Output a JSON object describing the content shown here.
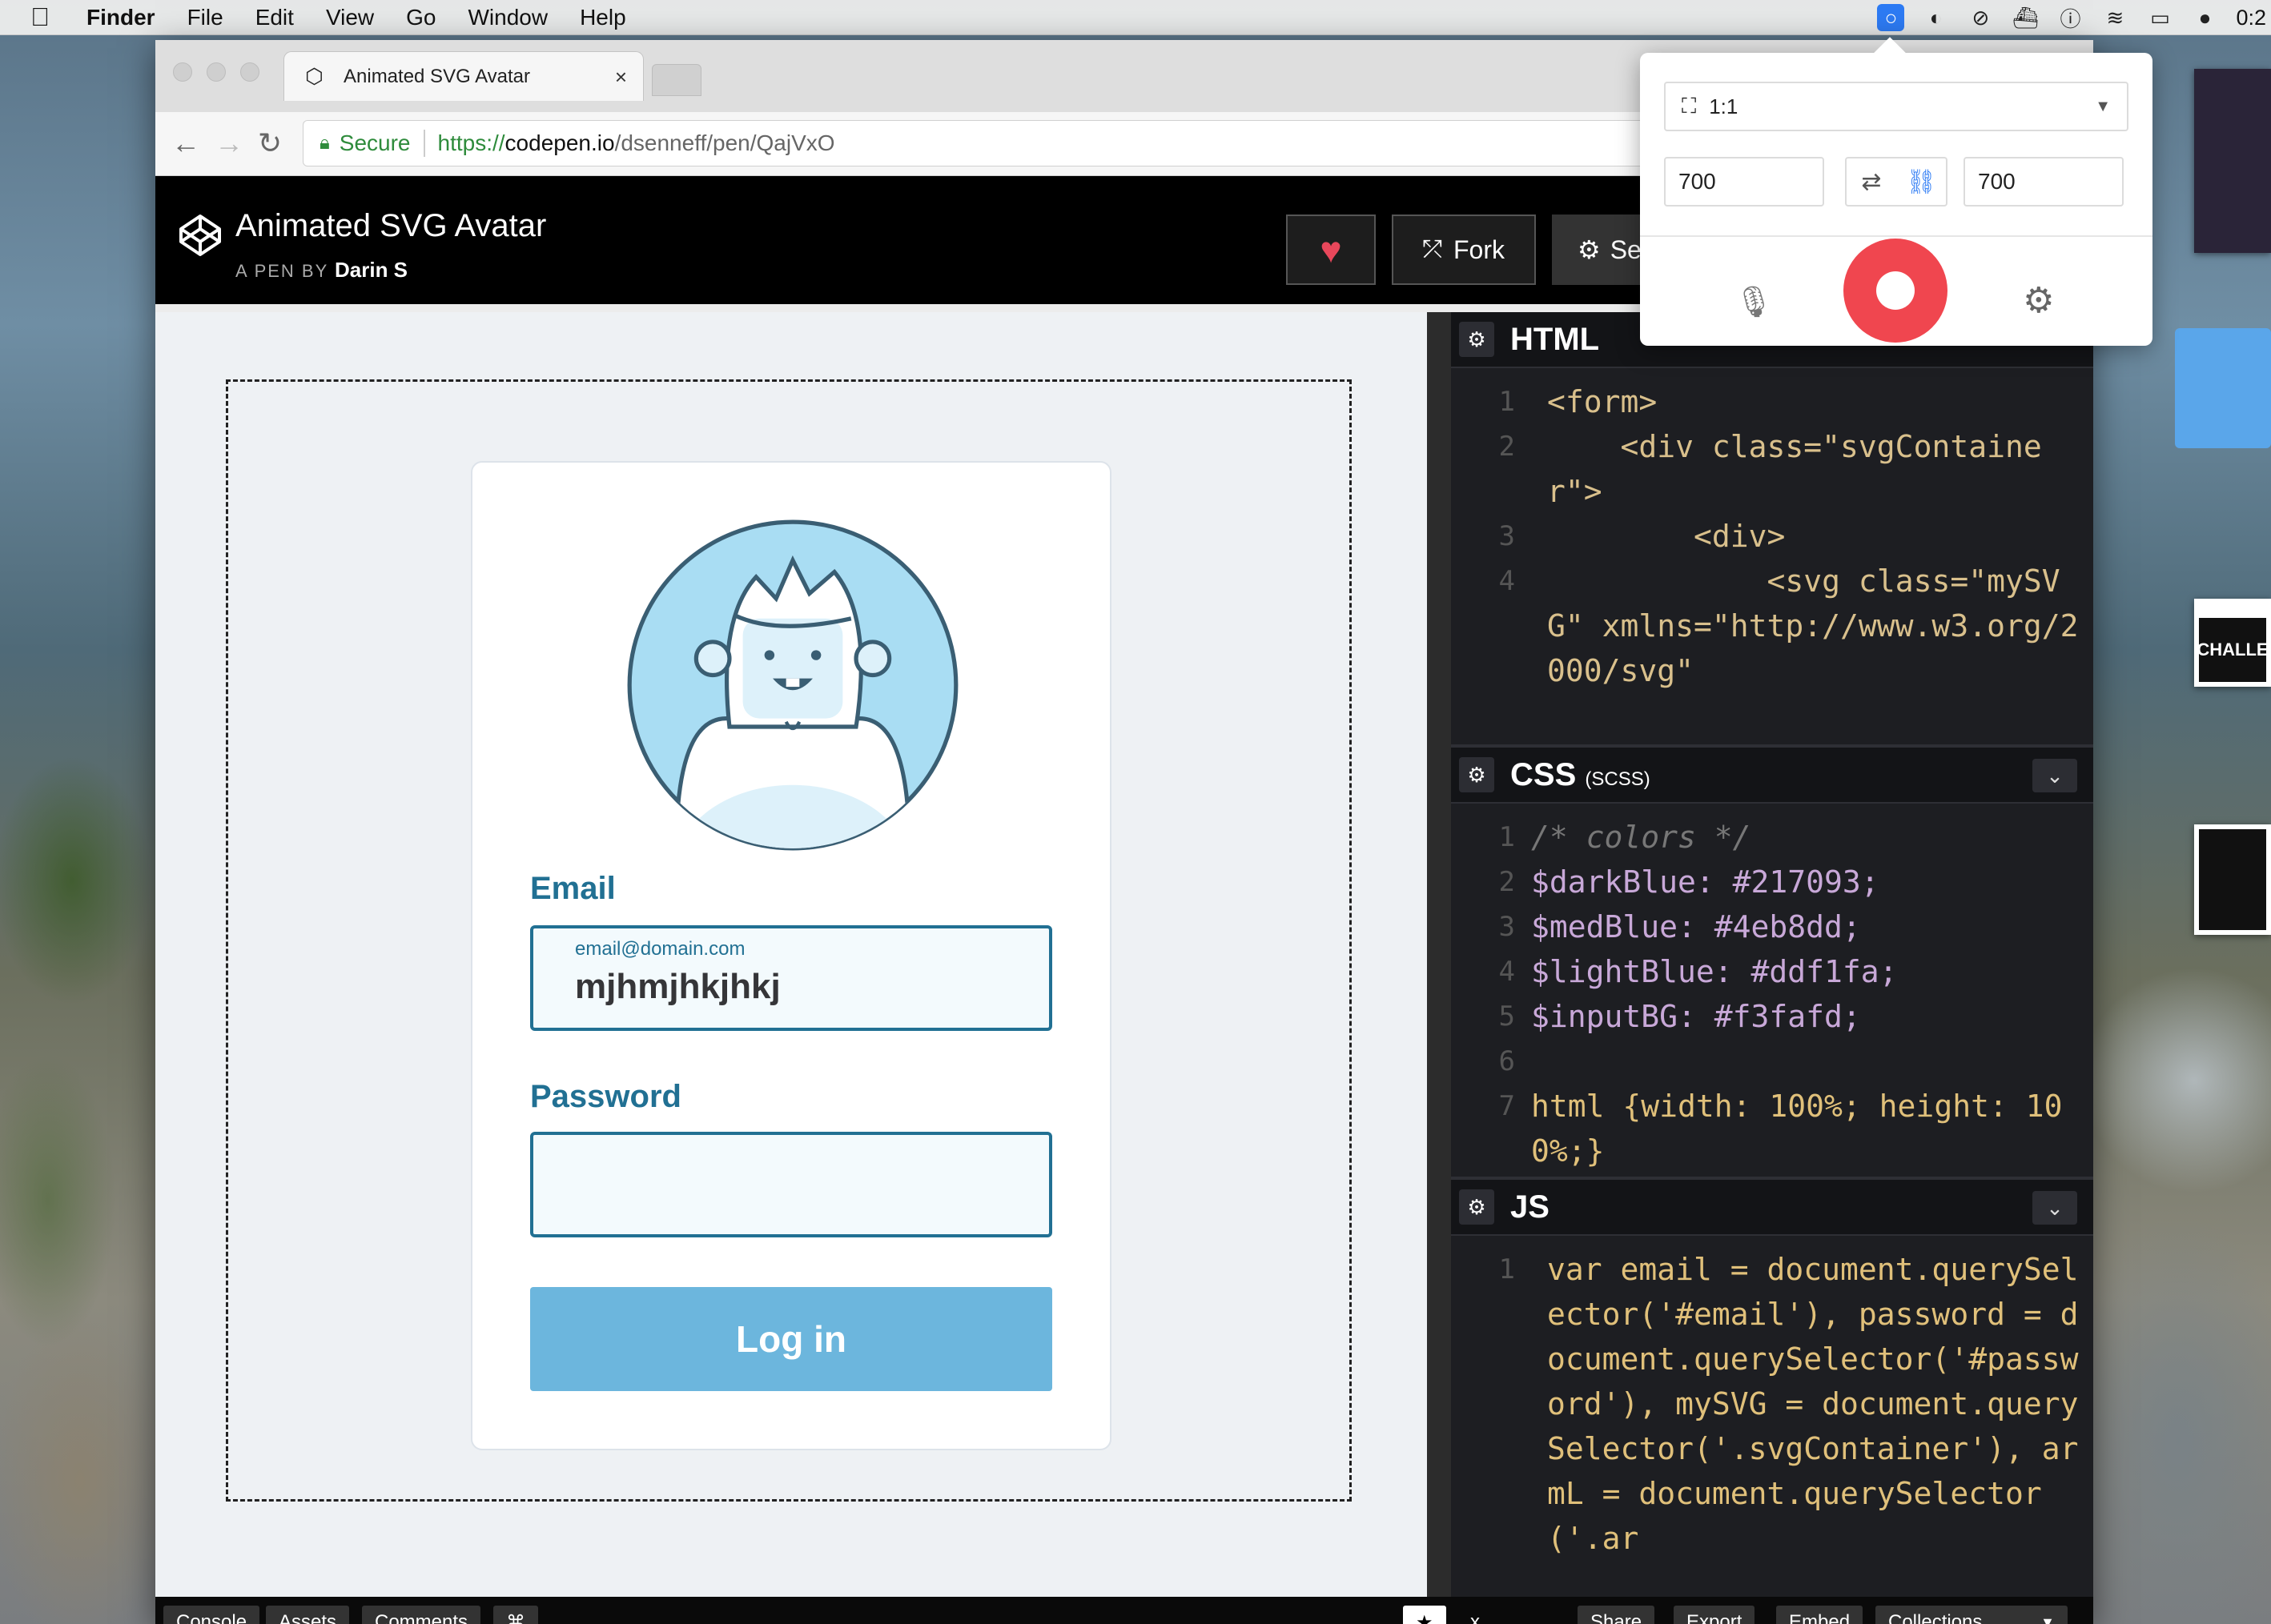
{
  "menubar": {
    "app": "Finder",
    "items": [
      "File",
      "Edit",
      "View",
      "Go",
      "Window",
      "Help"
    ],
    "clock": "0:2"
  },
  "browser": {
    "tab_title": "Animated SVG Avatar",
    "tab_close": "×",
    "url": {
      "secure_label": "Secure",
      "scheme": "https://",
      "host": "codepen.io",
      "path": "/dsenneff/pen/QajVxO"
    }
  },
  "codepen": {
    "title": "Animated SVG Avatar",
    "by_label": "A PEN BY",
    "author": "Darin S",
    "fork_label": "Fork",
    "settings_label": "Se"
  },
  "form": {
    "email_label": "Email",
    "email_hint": "email@domain.com",
    "email_value": "mjhmjhkjhkj",
    "password_label": "Password",
    "password_value": "",
    "login_label": "Log in"
  },
  "editors": {
    "html": {
      "name": "HTML",
      "lines": [
        {
          "n": "1",
          "text": "<form>"
        },
        {
          "n": "2",
          "text": "    <div class=\"svgContainer\">"
        },
        {
          "n": "3",
          "text": "        <div>"
        },
        {
          "n": "4",
          "text": "            <svg class=\"mySVG\" xmlns=\"http://www.w3.org/2000/svg\""
        }
      ]
    },
    "css": {
      "name": "CSS",
      "sub": "(SCSS)",
      "lines": [
        {
          "n": "1",
          "text": "/* colors */"
        },
        {
          "n": "2",
          "text": "$darkBlue: #217093;"
        },
        {
          "n": "3",
          "text": "$medBlue: #4eb8dd;"
        },
        {
          "n": "4",
          "text": "$lightBlue: #ddf1fa;"
        },
        {
          "n": "5",
          "text": "$inputBG: #f3fafd;"
        },
        {
          "n": "6",
          "text": ""
        },
        {
          "n": "7",
          "text": "html {width: 100%; height: 100%;}"
        }
      ]
    },
    "js": {
      "name": "JS",
      "lines": [
        {
          "n": "1",
          "text": "var email = document.querySelector('#email'), password = document.querySelector('#password'), mySVG = document.querySelector('.svgContainer'), armL = document.querySelector('.ar"
        }
      ]
    }
  },
  "bottom": {
    "console": "Console",
    "assets": "Assets",
    "comments": "Comments",
    "shortcut": "⌘",
    "star": "★",
    "close_x": "x",
    "share": "Share",
    "export": "Export",
    "embed": "Embed",
    "collections": "Collections"
  },
  "recorder": {
    "ratio": "1:1",
    "width": "700",
    "height": "700"
  },
  "desktop": {
    "thumb_text": "CHALLE"
  },
  "colors": {
    "darkBlue": "#217093",
    "medBlue": "#4eb8dd",
    "lightBlue": "#ddf1fa",
    "inputBG": "#f3fafd",
    "record": "#f0464f",
    "heart": "#e8475b"
  }
}
